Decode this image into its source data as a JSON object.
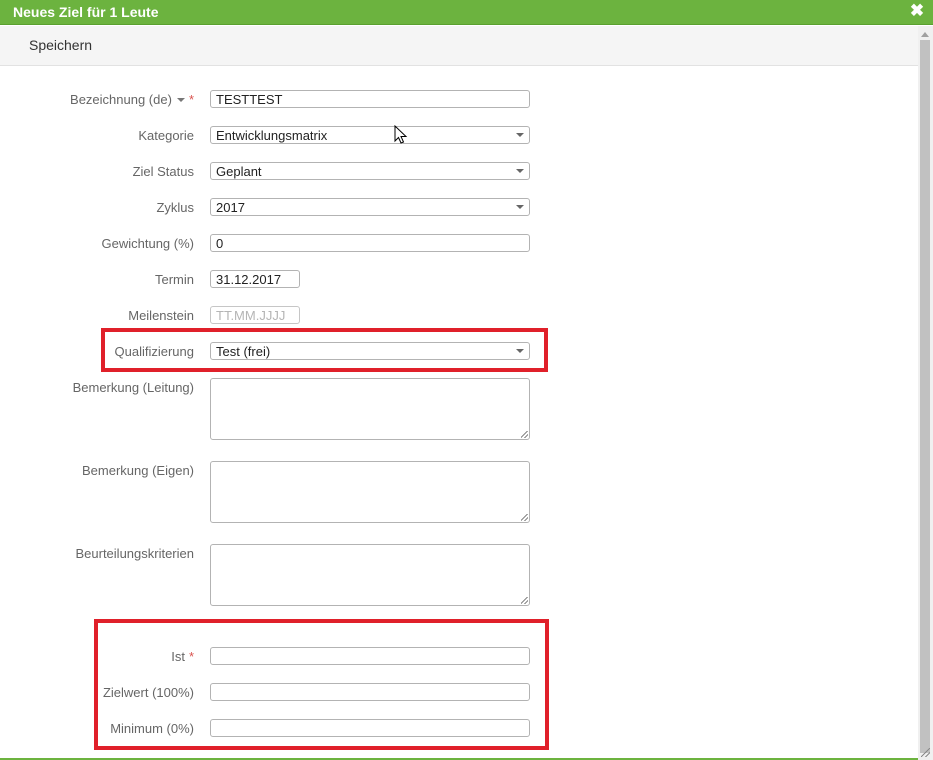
{
  "dialog": {
    "title": "Neues Ziel für 1 Leute",
    "close_icon": "close-icon"
  },
  "toolbar": {
    "save_label": "Speichern"
  },
  "form": {
    "bezeichnung": {
      "label": "Bezeichnung (de)",
      "required": "*",
      "value": "TESTTEST"
    },
    "kategorie": {
      "label": "Kategorie",
      "value": "Entwicklungsmatrix"
    },
    "ziel_status": {
      "label": "Ziel Status",
      "value": "Geplant"
    },
    "zyklus": {
      "label": "Zyklus",
      "value": "2017"
    },
    "gewichtung": {
      "label": "Gewichtung (%)",
      "value": "0"
    },
    "termin": {
      "label": "Termin",
      "value": "31.12.2017"
    },
    "meilenstein": {
      "label": "Meilenstein",
      "placeholder": "TT.MM.JJJJ"
    },
    "qualifizierung": {
      "label": "Qualifizierung",
      "value": "Test (frei)"
    },
    "bemerkung_leitung": {
      "label": "Bemerkung (Leitung)",
      "value": ""
    },
    "bemerkung_eigen": {
      "label": "Bemerkung (Eigen)",
      "value": ""
    },
    "beurteilungskriterien": {
      "label": "Beurteilungskriterien",
      "value": ""
    },
    "ist": {
      "label": "Ist",
      "required": "*",
      "value": ""
    },
    "zielwert": {
      "label": "Zielwert (100%)",
      "value": ""
    },
    "minimum": {
      "label": "Minimum (0%)",
      "value": ""
    }
  },
  "colors": {
    "titlebar": "#6cb33f",
    "highlight": "#e0202a",
    "required": "#d9534f"
  }
}
